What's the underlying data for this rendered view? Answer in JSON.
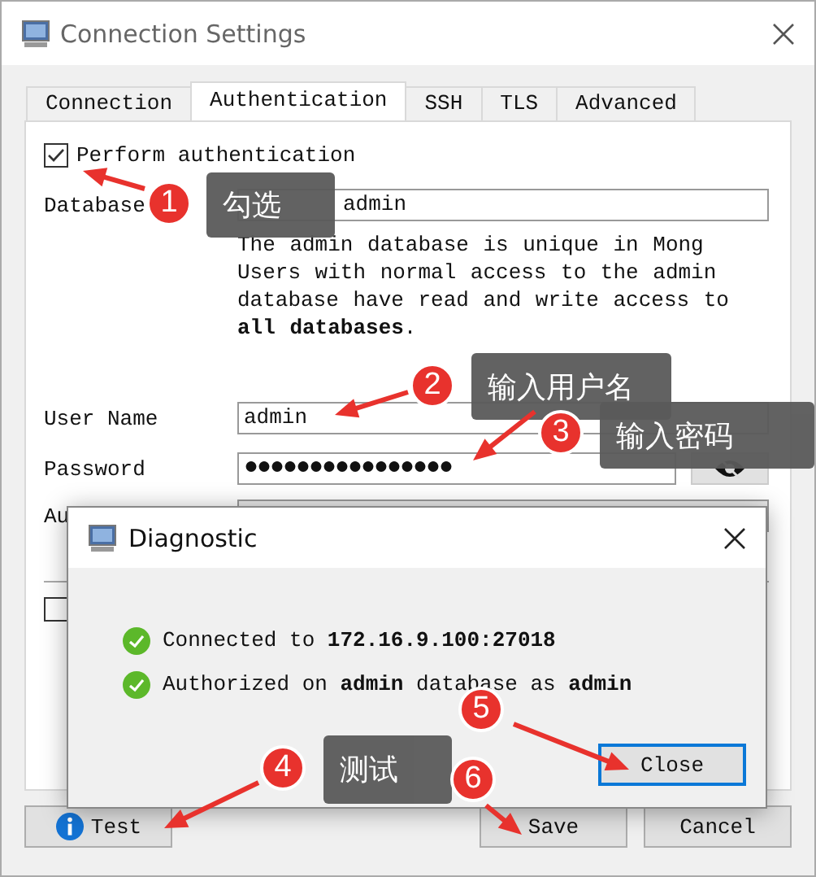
{
  "window": {
    "title": "Connection Settings"
  },
  "tabs": [
    {
      "label": "Connection",
      "selected": false
    },
    {
      "label": "Authentication",
      "selected": true
    },
    {
      "label": "SSH",
      "selected": false
    },
    {
      "label": "TLS",
      "selected": false
    },
    {
      "label": "Advanced",
      "selected": false
    }
  ],
  "perform_auth": {
    "label": "Perform authentication",
    "checked": true
  },
  "database": {
    "label": "Database",
    "value": "admin"
  },
  "description": "The admin database is unique in Mong\nUsers with normal access to the admin\ndatabase have read and write access to\n**all databases**.",
  "user_name": {
    "label": "User Name",
    "value": "admin"
  },
  "password": {
    "label": "Password",
    "value": "●●●●●●●●●●●●●●●●"
  },
  "auth_mechanism": {
    "label": "Au"
  },
  "lower_checkbox": {
    "checked": false
  },
  "buttons": {
    "test": "Test",
    "save": "Save",
    "cancel": "Cancel"
  },
  "dialog": {
    "title": "Diagnostic",
    "messages": [
      "Connected to **172.16.9.100:27018**",
      "Authorized on **admin** database as **admin**"
    ],
    "close": "Close"
  },
  "annotations": [
    {
      "number": "1",
      "label": "勾选"
    },
    {
      "number": "2",
      "label": "输入用户名"
    },
    {
      "number": "3",
      "label": "输入密码"
    },
    {
      "number": "4",
      "label": "测试"
    },
    {
      "number": "5"
    },
    {
      "number": "6"
    }
  ]
}
